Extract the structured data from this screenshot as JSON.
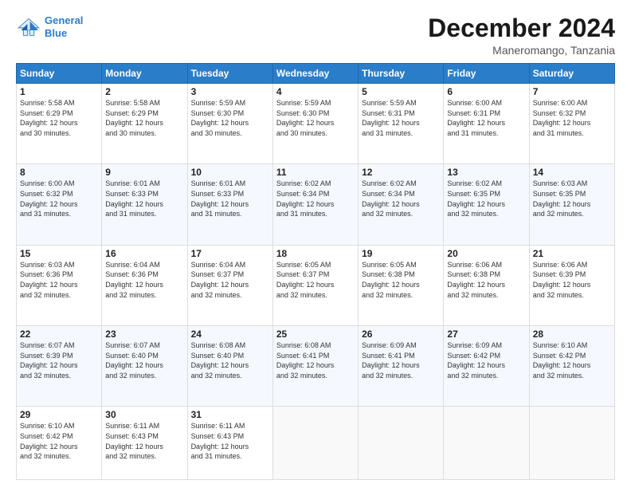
{
  "header": {
    "logo_line1": "General",
    "logo_line2": "Blue",
    "month": "December 2024",
    "location": "Maneromango, Tanzania"
  },
  "days_of_week": [
    "Sunday",
    "Monday",
    "Tuesday",
    "Wednesday",
    "Thursday",
    "Friday",
    "Saturday"
  ],
  "weeks": [
    [
      {
        "day": 1,
        "info": "Sunrise: 5:58 AM\nSunset: 6:29 PM\nDaylight: 12 hours\nand 30 minutes."
      },
      {
        "day": 2,
        "info": "Sunrise: 5:58 AM\nSunset: 6:29 PM\nDaylight: 12 hours\nand 30 minutes."
      },
      {
        "day": 3,
        "info": "Sunrise: 5:59 AM\nSunset: 6:30 PM\nDaylight: 12 hours\nand 30 minutes."
      },
      {
        "day": 4,
        "info": "Sunrise: 5:59 AM\nSunset: 6:30 PM\nDaylight: 12 hours\nand 30 minutes."
      },
      {
        "day": 5,
        "info": "Sunrise: 5:59 AM\nSunset: 6:31 PM\nDaylight: 12 hours\nand 31 minutes."
      },
      {
        "day": 6,
        "info": "Sunrise: 6:00 AM\nSunset: 6:31 PM\nDaylight: 12 hours\nand 31 minutes."
      },
      {
        "day": 7,
        "info": "Sunrise: 6:00 AM\nSunset: 6:32 PM\nDaylight: 12 hours\nand 31 minutes."
      }
    ],
    [
      {
        "day": 8,
        "info": "Sunrise: 6:00 AM\nSunset: 6:32 PM\nDaylight: 12 hours\nand 31 minutes."
      },
      {
        "day": 9,
        "info": "Sunrise: 6:01 AM\nSunset: 6:33 PM\nDaylight: 12 hours\nand 31 minutes."
      },
      {
        "day": 10,
        "info": "Sunrise: 6:01 AM\nSunset: 6:33 PM\nDaylight: 12 hours\nand 31 minutes."
      },
      {
        "day": 11,
        "info": "Sunrise: 6:02 AM\nSunset: 6:34 PM\nDaylight: 12 hours\nand 31 minutes."
      },
      {
        "day": 12,
        "info": "Sunrise: 6:02 AM\nSunset: 6:34 PM\nDaylight: 12 hours\nand 32 minutes."
      },
      {
        "day": 13,
        "info": "Sunrise: 6:02 AM\nSunset: 6:35 PM\nDaylight: 12 hours\nand 32 minutes."
      },
      {
        "day": 14,
        "info": "Sunrise: 6:03 AM\nSunset: 6:35 PM\nDaylight: 12 hours\nand 32 minutes."
      }
    ],
    [
      {
        "day": 15,
        "info": "Sunrise: 6:03 AM\nSunset: 6:36 PM\nDaylight: 12 hours\nand 32 minutes."
      },
      {
        "day": 16,
        "info": "Sunrise: 6:04 AM\nSunset: 6:36 PM\nDaylight: 12 hours\nand 32 minutes."
      },
      {
        "day": 17,
        "info": "Sunrise: 6:04 AM\nSunset: 6:37 PM\nDaylight: 12 hours\nand 32 minutes."
      },
      {
        "day": 18,
        "info": "Sunrise: 6:05 AM\nSunset: 6:37 PM\nDaylight: 12 hours\nand 32 minutes."
      },
      {
        "day": 19,
        "info": "Sunrise: 6:05 AM\nSunset: 6:38 PM\nDaylight: 12 hours\nand 32 minutes."
      },
      {
        "day": 20,
        "info": "Sunrise: 6:06 AM\nSunset: 6:38 PM\nDaylight: 12 hours\nand 32 minutes."
      },
      {
        "day": 21,
        "info": "Sunrise: 6:06 AM\nSunset: 6:39 PM\nDaylight: 12 hours\nand 32 minutes."
      }
    ],
    [
      {
        "day": 22,
        "info": "Sunrise: 6:07 AM\nSunset: 6:39 PM\nDaylight: 12 hours\nand 32 minutes."
      },
      {
        "day": 23,
        "info": "Sunrise: 6:07 AM\nSunset: 6:40 PM\nDaylight: 12 hours\nand 32 minutes."
      },
      {
        "day": 24,
        "info": "Sunrise: 6:08 AM\nSunset: 6:40 PM\nDaylight: 12 hours\nand 32 minutes."
      },
      {
        "day": 25,
        "info": "Sunrise: 6:08 AM\nSunset: 6:41 PM\nDaylight: 12 hours\nand 32 minutes."
      },
      {
        "day": 26,
        "info": "Sunrise: 6:09 AM\nSunset: 6:41 PM\nDaylight: 12 hours\nand 32 minutes."
      },
      {
        "day": 27,
        "info": "Sunrise: 6:09 AM\nSunset: 6:42 PM\nDaylight: 12 hours\nand 32 minutes."
      },
      {
        "day": 28,
        "info": "Sunrise: 6:10 AM\nSunset: 6:42 PM\nDaylight: 12 hours\nand 32 minutes."
      }
    ],
    [
      {
        "day": 29,
        "info": "Sunrise: 6:10 AM\nSunset: 6:42 PM\nDaylight: 12 hours\nand 32 minutes."
      },
      {
        "day": 30,
        "info": "Sunrise: 6:11 AM\nSunset: 6:43 PM\nDaylight: 12 hours\nand 32 minutes."
      },
      {
        "day": 31,
        "info": "Sunrise: 6:11 AM\nSunset: 6:43 PM\nDaylight: 12 hours\nand 31 minutes."
      },
      null,
      null,
      null,
      null
    ]
  ]
}
